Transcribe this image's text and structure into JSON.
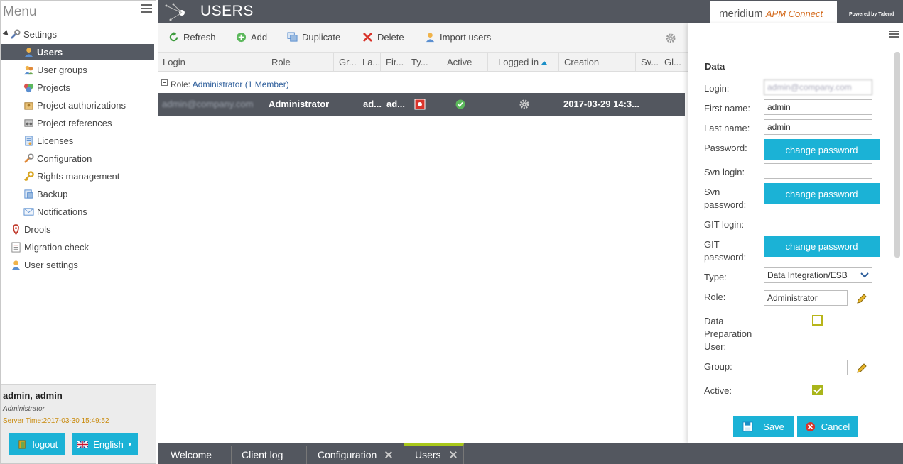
{
  "menu": {
    "title": "Menu",
    "items": [
      {
        "label": "Settings",
        "icon": "wrench-icon"
      },
      {
        "label": "Users",
        "icon": "user-icon"
      },
      {
        "label": "User groups",
        "icon": "user-group-icon"
      },
      {
        "label": "Projects",
        "icon": "projects-icon"
      },
      {
        "label": "Project authorizations",
        "icon": "authorization-icon"
      },
      {
        "label": "Project references",
        "icon": "reference-icon"
      },
      {
        "label": "Licenses",
        "icon": "license-icon"
      },
      {
        "label": "Configuration",
        "icon": "wrench-icon"
      },
      {
        "label": "Rights management",
        "icon": "key-icon"
      },
      {
        "label": "Backup",
        "icon": "backup-icon"
      },
      {
        "label": "Notifications",
        "icon": "envelope-icon"
      },
      {
        "label": "Drools",
        "icon": "drools-icon"
      },
      {
        "label": "Migration check",
        "icon": "checklist-icon"
      },
      {
        "label": "User settings",
        "icon": "user-icon"
      }
    ]
  },
  "user_panel": {
    "name": "admin, admin",
    "role": "Administrator",
    "server_time": "Server Time:2017-03-30 15:49:52",
    "logout_label": "logout",
    "language_label": "English"
  },
  "header": {
    "title": "USERS",
    "brand": "meridium",
    "brand_sub": "APM Connect",
    "powered_by": "Powered by Talend"
  },
  "toolbar": {
    "refresh_label": "Refresh",
    "add_label": "Add",
    "duplicate_label": "Duplicate",
    "delete_label": "Delete",
    "import_label": "Import users"
  },
  "grid": {
    "columns": [
      "Login",
      "Role",
      "Gr...",
      "La...",
      "Fir...",
      "Ty...",
      "Active",
      "Logged in",
      "Creation",
      "Sv...",
      "Gl..."
    ],
    "group": {
      "prefix": "Role: ",
      "value": "Administrator (1 Member)"
    },
    "rows": [
      {
        "login": "admin@company.com",
        "role": "Administrator",
        "last": "ad...",
        "first": "ad...",
        "creation": "2017-03-29 14:3..."
      }
    ]
  },
  "form": {
    "heading": "Data",
    "login_label": "Login:",
    "login_value": "admin@company.com",
    "first_name_label": "First name:",
    "first_name_value": "admin",
    "last_name_label": "Last name:",
    "last_name_value": "admin",
    "password_label": "Password:",
    "svn_login_label": "Svn login:",
    "svn_password_label_1": "Svn",
    "svn_password_label_2": "password:",
    "git_login_label": "GIT login:",
    "git_password_label_1": "GIT",
    "git_password_label_2": "password:",
    "change_password_label": "change password",
    "type_label": "Type:",
    "type_value": "Data Integration/ESB",
    "role_label": "Role:",
    "role_value": "Administrator",
    "data_prep_label_1": "Data",
    "data_prep_label_2": "Preparation",
    "data_prep_label_3": "User:",
    "group_label": "Group:",
    "active_label": "Active:",
    "save_label": "Save",
    "cancel_label": "Cancel"
  },
  "tabs": [
    {
      "label": "Welcome"
    },
    {
      "label": "Client log"
    },
    {
      "label": "Configuration"
    },
    {
      "label": "Users"
    }
  ],
  "colors": {
    "accent": "#1bb2d6",
    "header_bg": "#53575f",
    "checkbox": "#a9b51a"
  }
}
